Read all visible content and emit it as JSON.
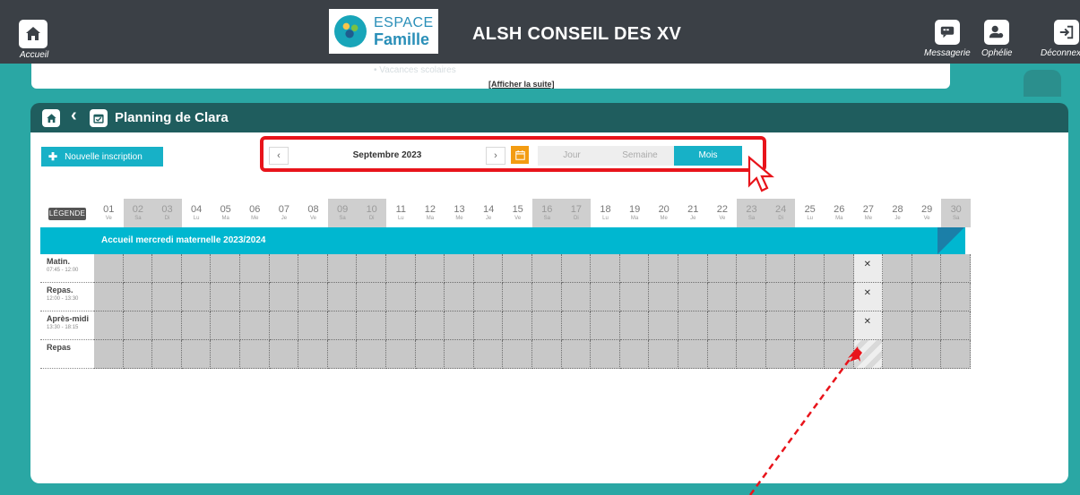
{
  "topbar": {
    "home_label": "Accueil",
    "logo_line1": "ESPACE",
    "logo_line2": "Famille",
    "title": "ALSH CONSEIL DES XV",
    "tools": [
      {
        "label": "Messagerie",
        "icon": "chat-icon"
      },
      {
        "label": "Ophélie",
        "icon": "user-settings-icon"
      },
      {
        "label": "Déconnexion",
        "icon": "logout-icon"
      }
    ]
  },
  "announce": {
    "faded_text": "• Vacances scolaires",
    "link": "[Afficher la suite]"
  },
  "panel": {
    "title": "Planning de Clara",
    "new_button": "Nouvelle inscription"
  },
  "nav": {
    "month": "Septembre 2023",
    "views": [
      "Jour",
      "Semaine",
      "Mois"
    ],
    "active_view": "Mois"
  },
  "calendar": {
    "legend": "LÉGENDE",
    "days": [
      {
        "n": "01",
        "d": "Ve",
        "we": false
      },
      {
        "n": "02",
        "d": "Sa",
        "we": true
      },
      {
        "n": "03",
        "d": "Di",
        "we": true
      },
      {
        "n": "04",
        "d": "Lu",
        "we": false
      },
      {
        "n": "05",
        "d": "Ma",
        "we": false
      },
      {
        "n": "06",
        "d": "Me",
        "we": false
      },
      {
        "n": "07",
        "d": "Je",
        "we": false
      },
      {
        "n": "08",
        "d": "Ve",
        "we": false
      },
      {
        "n": "09",
        "d": "Sa",
        "we": true
      },
      {
        "n": "10",
        "d": "Di",
        "we": true
      },
      {
        "n": "11",
        "d": "Lu",
        "we": false
      },
      {
        "n": "12",
        "d": "Ma",
        "we": false
      },
      {
        "n": "13",
        "d": "Me",
        "we": false
      },
      {
        "n": "14",
        "d": "Je",
        "we": false
      },
      {
        "n": "15",
        "d": "Ve",
        "we": false
      },
      {
        "n": "16",
        "d": "Sa",
        "we": true
      },
      {
        "n": "17",
        "d": "Di",
        "we": true
      },
      {
        "n": "18",
        "d": "Lu",
        "we": false
      },
      {
        "n": "19",
        "d": "Ma",
        "we": false
      },
      {
        "n": "20",
        "d": "Me",
        "we": false
      },
      {
        "n": "21",
        "d": "Je",
        "we": false
      },
      {
        "n": "22",
        "d": "Ve",
        "we": false
      },
      {
        "n": "23",
        "d": "Sa",
        "we": true
      },
      {
        "n": "24",
        "d": "Di",
        "we": true
      },
      {
        "n": "25",
        "d": "Lu",
        "we": false
      },
      {
        "n": "26",
        "d": "Ma",
        "we": false
      },
      {
        "n": "27",
        "d": "Me",
        "we": false
      },
      {
        "n": "28",
        "d": "Je",
        "we": false
      },
      {
        "n": "29",
        "d": "Ve",
        "we": false
      },
      {
        "n": "30",
        "d": "Sa",
        "we": true
      }
    ],
    "activity": "Accueil mercredi maternelle 2023/2024",
    "rows": [
      {
        "label": "Matin.",
        "time": "07:45 - 12:00",
        "icon_day": "27"
      },
      {
        "label": "Repas.",
        "time": "12:00 - 13:30",
        "icon_day": "27"
      },
      {
        "label": "Après-midi",
        "time": "13:30 - 18:15",
        "icon_day": "27"
      },
      {
        "label": "Repas",
        "time": "",
        "icon_day": ""
      }
    ]
  },
  "colors": {
    "accent": "#17b1c7",
    "highlight": "#e8141b",
    "header": "#1f5d5e",
    "topbar": "#3b4046",
    "background": "#2aa7a4"
  }
}
